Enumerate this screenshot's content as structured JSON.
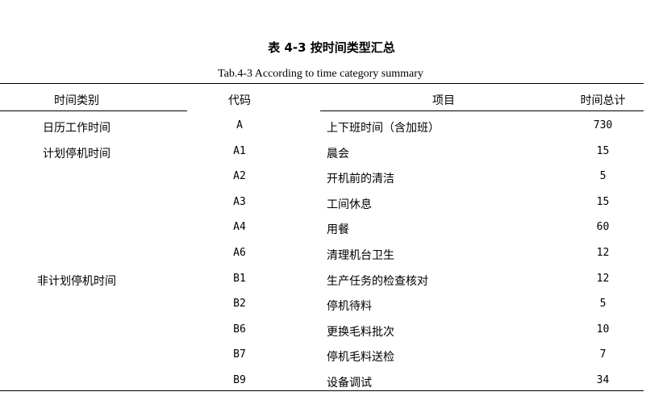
{
  "title_zh": "表 4-3 按时间类型汇总",
  "title_en": "Tab.4-3 According to time category summary",
  "headers": [
    "时间类别",
    "代码",
    "项目",
    "时间总计"
  ],
  "rows": [
    {
      "category": "日历工作时间",
      "code": "A",
      "item": "上下班时间（含加班）",
      "total": "730"
    },
    {
      "category": "计划停机时间",
      "code": "A1",
      "item": "晨会",
      "total": "15"
    },
    {
      "category": "",
      "code": "A2",
      "item": "开机前的清洁",
      "total": "5"
    },
    {
      "category": "",
      "code": "A3",
      "item": "工间休息",
      "total": "15"
    },
    {
      "category": "",
      "code": "A4",
      "item": "用餐",
      "total": "60"
    },
    {
      "category": "",
      "code": "A6",
      "item": "清理机台卫生",
      "total": "12"
    },
    {
      "category": "非计划停机时间",
      "code": "B1",
      "item": "生产任务的检查核对",
      "total": "12"
    },
    {
      "category": "",
      "code": "B2",
      "item": "停机待料",
      "total": "5"
    },
    {
      "category": "",
      "code": "B6",
      "item": "更换毛料批次",
      "total": "10"
    },
    {
      "category": "",
      "code": "B7",
      "item": "停机毛料送检",
      "total": "7"
    },
    {
      "category": "",
      "code": "B9",
      "item": "设备调试",
      "total": "34"
    }
  ]
}
